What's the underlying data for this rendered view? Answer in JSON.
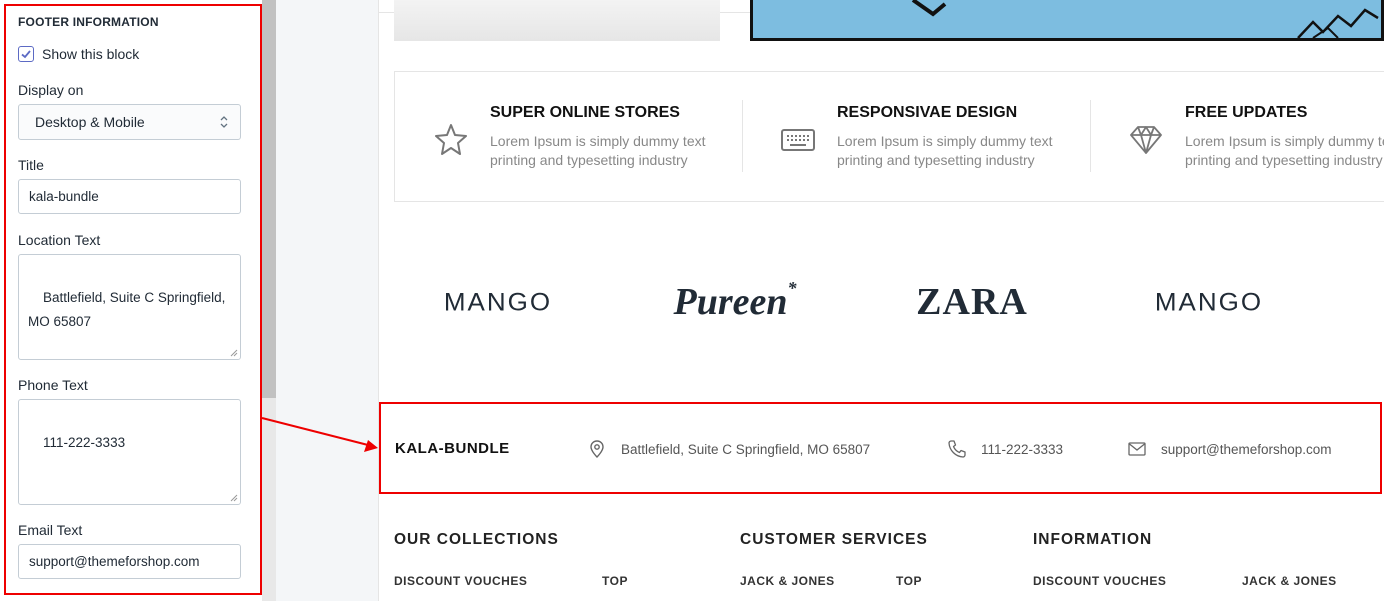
{
  "panel": {
    "heading": "FOOTER INFORMATION",
    "show_block_label": "Show this block",
    "show_block_checked": true,
    "display_on_label": "Display on",
    "display_on_value": "Desktop & Mobile",
    "title_label": "Title",
    "title_value": "kala-bundle",
    "location_label": "Location Text",
    "location_value": "Battlefield, Suite C Springfield,\nMO 65807",
    "phone_label": "Phone Text",
    "phone_value": "111-222-3333",
    "email_label": "Email Text",
    "email_value": "support@themeforshop.com"
  },
  "features": [
    {
      "title": "SUPER ONLINE STORES",
      "text": "Lorem Ipsum is simply dummy text printing and typesetting industry",
      "icon": "star-icon"
    },
    {
      "title": "RESPONSIVAE DESIGN",
      "text": "Lorem Ipsum is simply dummy text printing and typesetting industry",
      "icon": "keyboard-icon"
    },
    {
      "title": "FREE UPDATES",
      "text": "Lorem Ipsum is simply dummy text printing and typesetting industry",
      "icon": "diamond-icon"
    }
  ],
  "brands": [
    "MANGO",
    "Pureen",
    "ZARA",
    "MANGO"
  ],
  "footer_info": {
    "title": "KALA-BUNDLE",
    "location": "Battlefield, Suite C Springfield, MO 65807",
    "phone": "111-222-3333",
    "email": "support@themeforshop.com"
  },
  "footer_columns": {
    "col1_title": "OUR COLLECTIONS",
    "col2_title": "CUSTOMER SERVICES",
    "col3_title": "INFORMATION",
    "links": [
      "DISCOUNT VOUCHES",
      "TOP",
      "JACK & JONES",
      "TOP",
      "DISCOUNT VOUCHES",
      "JACK & JONES"
    ]
  },
  "colors": {
    "highlight": "#ee0000",
    "checkbox": "#5c6ac4",
    "top_image": "#7dbde0"
  }
}
